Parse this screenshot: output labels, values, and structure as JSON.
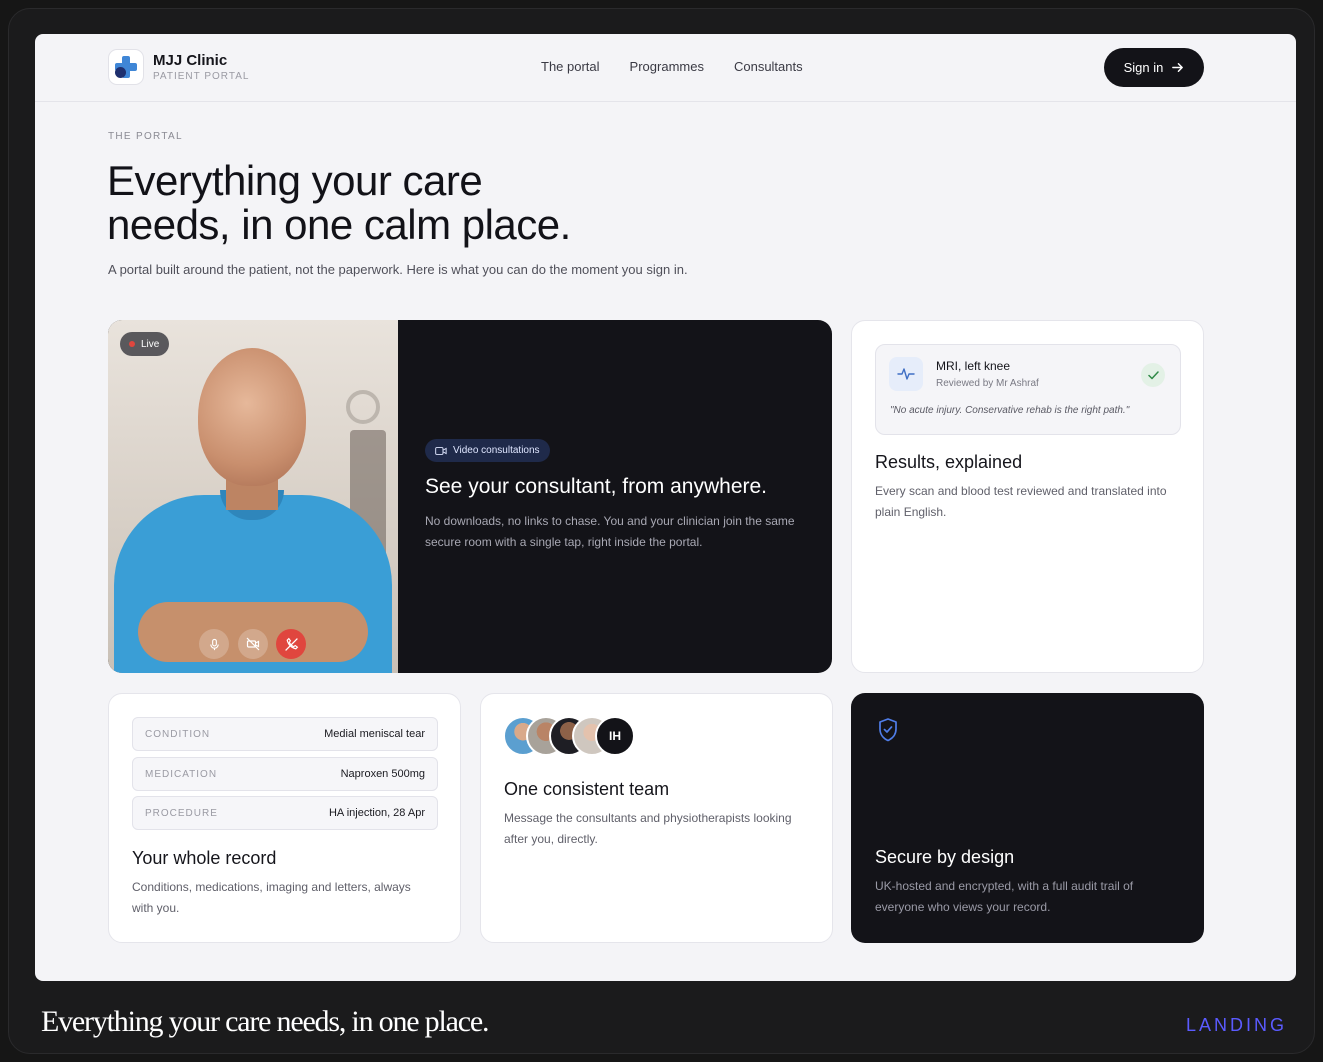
{
  "header": {
    "brand_name": "MJJ Clinic",
    "brand_sub": "PATIENT PORTAL",
    "nav": [
      "The portal",
      "Programmes",
      "Consultants"
    ],
    "signin_label": "Sign in"
  },
  "hero": {
    "eyebrow": "THE PORTAL",
    "title_line1": "Everything your care",
    "title_line2": "needs, in one calm place.",
    "subtitle": "A portal built around the patient, not the paperwork. Here is what you can do the moment you sign in."
  },
  "video_card": {
    "live_label": "Live",
    "pill_label": "Video consultations",
    "title": "See your consultant, from anywhere.",
    "body": "No downloads, no links to chase. You and your clinician join the same secure room with a single tap, right inside the portal."
  },
  "results_card": {
    "mri_title": "MRI, left knee",
    "mri_sub": "Reviewed by Mr Ashraf",
    "mri_quote": "\"No acute injury. Conservative rehab is the right path.\"",
    "title": "Results, explained",
    "body": "Every scan and blood test reviewed and translated into plain English."
  },
  "record_card": {
    "rows": [
      {
        "key": "CONDITION",
        "value": "Medial meniscal tear"
      },
      {
        "key": "MEDICATION",
        "value": "Naproxen 500mg"
      },
      {
        "key": "PROCEDURE",
        "value": "HA injection, 28 Apr"
      }
    ],
    "title": "Your whole record",
    "body": "Conditions, medications, imaging and letters, always with you."
  },
  "team_card": {
    "initials": "IH",
    "title": "One consistent team",
    "body": "Message the consultants and physiotherapists looking after you, directly."
  },
  "secure_card": {
    "title": "Secure by design",
    "body": "UK-hosted and encrypted, with a full audit trail of everyone who views your record."
  },
  "footer": {
    "caption": "Everything your care needs, in one place.",
    "tag": "LANDING"
  },
  "colors": {
    "accent": "#3f86d6",
    "dark": "#131318",
    "live": "#e0463e",
    "tag": "#5b5bff"
  }
}
